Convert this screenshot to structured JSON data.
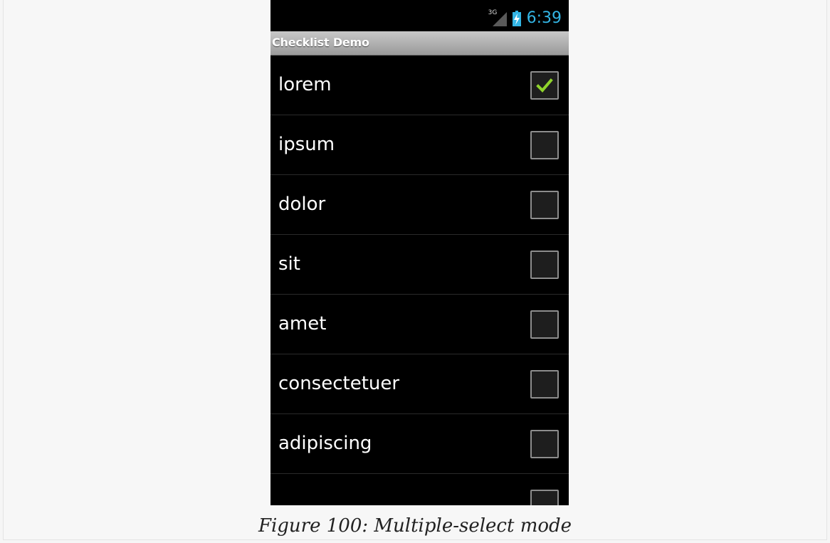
{
  "status_bar": {
    "network_label": "3G",
    "clock": "6:39",
    "clock_color": "#33b5e5",
    "icons": [
      "signal-icon",
      "battery-charging-icon"
    ]
  },
  "action_bar": {
    "title": "Checklist Demo"
  },
  "list": {
    "items": [
      {
        "label": "lorem",
        "checked": true
      },
      {
        "label": "ipsum",
        "checked": false
      },
      {
        "label": "dolor",
        "checked": false
      },
      {
        "label": "sit",
        "checked": false
      },
      {
        "label": "amet",
        "checked": false
      },
      {
        "label": "consectetuer",
        "checked": false
      },
      {
        "label": "adipiscing",
        "checked": false
      },
      {
        "label": "",
        "checked": false
      }
    ]
  },
  "colors": {
    "check_green": "#8fd32c",
    "phone_background": "#000000"
  },
  "caption": "Figure 100: Multiple-select mode"
}
